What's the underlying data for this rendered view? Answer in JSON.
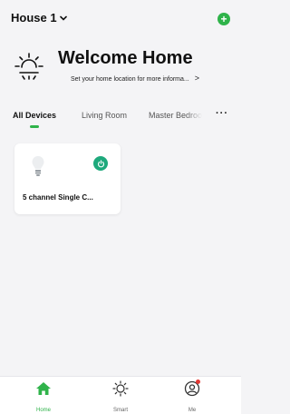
{
  "header": {
    "house_name": "House 1",
    "add_button_glyph": "+"
  },
  "welcome": {
    "title": "Welcome Home",
    "subtitle": "Set your home location for more informa...",
    "arrow": ">"
  },
  "tabs": [
    {
      "label": "All Devices",
      "active": true
    },
    {
      "label": "Living Room",
      "active": false
    },
    {
      "label": "Master Bedroo",
      "active": false
    }
  ],
  "more_glyph": "···",
  "devices": [
    {
      "name": "5 channel Single C...",
      "icon": "lightbulb-icon",
      "power_on": true
    }
  ],
  "nav": [
    {
      "label": "Home",
      "icon": "home-icon",
      "active": true
    },
    {
      "label": "Smart",
      "icon": "sun-icon",
      "active": false
    },
    {
      "label": "Me",
      "icon": "profile-icon",
      "active": false,
      "badge": true
    }
  ],
  "colors": {
    "accent": "#2fb34a",
    "power_button": "#1ea97c",
    "background": "#f4f4f6",
    "badge": "#e53935"
  }
}
